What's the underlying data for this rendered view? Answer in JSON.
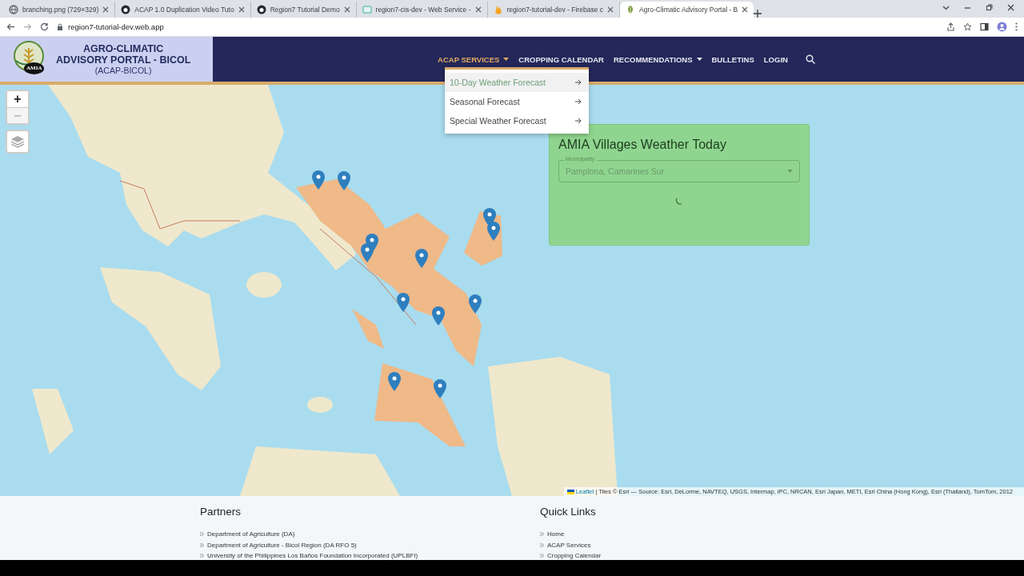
{
  "browser": {
    "tabs": [
      {
        "title": "branching.png (729×329)",
        "kind": "globe",
        "selected": false
      },
      {
        "title": "ACAP 1.0 Duplication Video Tuto",
        "kind": "github",
        "selected": false
      },
      {
        "title": "Region7 Tutorial Demo",
        "kind": "github",
        "selected": false
      },
      {
        "title": "region7-cis-dev - Web Service -",
        "kind": "service",
        "selected": false
      },
      {
        "title": "region7-tutorial-dev - Firebase c",
        "kind": "firebase",
        "selected": false
      },
      {
        "title": "Agro-Climatic Advisory Portal - B",
        "kind": "leaf",
        "selected": true
      }
    ],
    "address": "region7-tutorial-dev.web.app"
  },
  "header": {
    "logo_badge": "AMIA",
    "title_lines": [
      "AGRO-CLIMATIC",
      "ADVISORY PORTAL - BICOL"
    ],
    "subtitle": "(ACAP-BICOL)",
    "nav": [
      {
        "label": "ACAP SERVICES",
        "selected": true,
        "dropdown": true
      },
      {
        "label": "CROPPING CALENDAR",
        "selected": false,
        "dropdown": false
      },
      {
        "label": "RECOMMENDATIONS",
        "selected": false,
        "dropdown": true
      },
      {
        "label": "BULLETINS",
        "selected": false,
        "dropdown": false
      },
      {
        "label": "LOGIN",
        "selected": false,
        "dropdown": false
      }
    ],
    "menu": [
      {
        "label": "10-Day Weather Forecast",
        "hovered": true
      },
      {
        "label": "Seasonal Forecast",
        "hovered": false
      },
      {
        "label": "Special Weather Forecast",
        "hovered": false
      }
    ]
  },
  "map": {
    "zoom_in": "+",
    "zoom_out": {
      "label": "−",
      "disabled": true
    },
    "weather_card": {
      "title": "AMIA Villages Weather Today",
      "field": {
        "label": "Municipality",
        "value": "Pamplona, Camarines Sur"
      },
      "loading": true
    },
    "attribution": {
      "link": "Leaflet",
      "text": " | Tiles © Esri — Source: Esri, DeLorme, NAVTEQ, USGS, Intermap, iPC, NRCAN, Esri Japan, METI, Esri China (Hong Kong), Esri (Thailand), TomTom, 2012"
    }
  },
  "footer": {
    "columns": [
      {
        "heading": "Partners",
        "links": [
          "Department of Agriculture (DA)",
          "Department of Agriculture - Bicol Region (DA RFO 5)",
          "University of the Philippines Los Baños Foundation Incorporated (UPLBFI)"
        ]
      },
      {
        "heading": "Quick Links",
        "links": [
          "Home",
          "ACAP Services",
          "Cropping Calendar"
        ]
      }
    ]
  }
}
